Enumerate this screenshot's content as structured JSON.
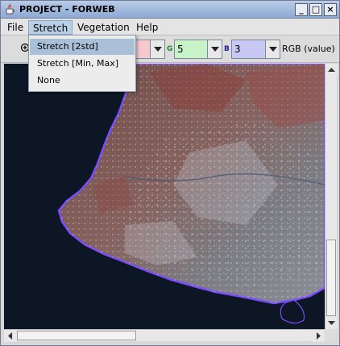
{
  "window": {
    "title": "PROJECT - FORWEB",
    "controls": {
      "minimize": "_",
      "maximize": "□",
      "close": "×"
    }
  },
  "menubar": {
    "items": [
      {
        "label": "File"
      },
      {
        "label": "Stretch"
      },
      {
        "label": "Vegetation"
      },
      {
        "label": "Help"
      }
    ]
  },
  "stretch_menu": {
    "items": [
      {
        "label": "Stretch [2std]",
        "highlighted": true
      },
      {
        "label": "Stretch [Min, Max]",
        "highlighted": false
      },
      {
        "label": "None",
        "highlighted": false
      }
    ]
  },
  "toolbar": {
    "zoom_icon": "zoom-icon",
    "red_band": {
      "label": "",
      "value": ""
    },
    "green_band": {
      "label": "G",
      "value": "5"
    },
    "blue_band": {
      "label": "B",
      "value": "3"
    },
    "rgb_button": "RGB (value)"
  },
  "colors": {
    "red_combo": "#f5c9cd",
    "green_combo": "#c8f2c8",
    "blue_combo": "#c8c8f5",
    "green_label": "#1b8a1b",
    "blue_label": "#2020a0",
    "menu_highlight": "#a9c0d8",
    "water": "#0c1624",
    "coast_glow": "#7a4bff"
  },
  "image_view": {
    "icon": "satellite-image"
  },
  "scrollbars": {
    "vertical": "vertical-scrollbar",
    "horizontal": "horizontal-scrollbar"
  }
}
